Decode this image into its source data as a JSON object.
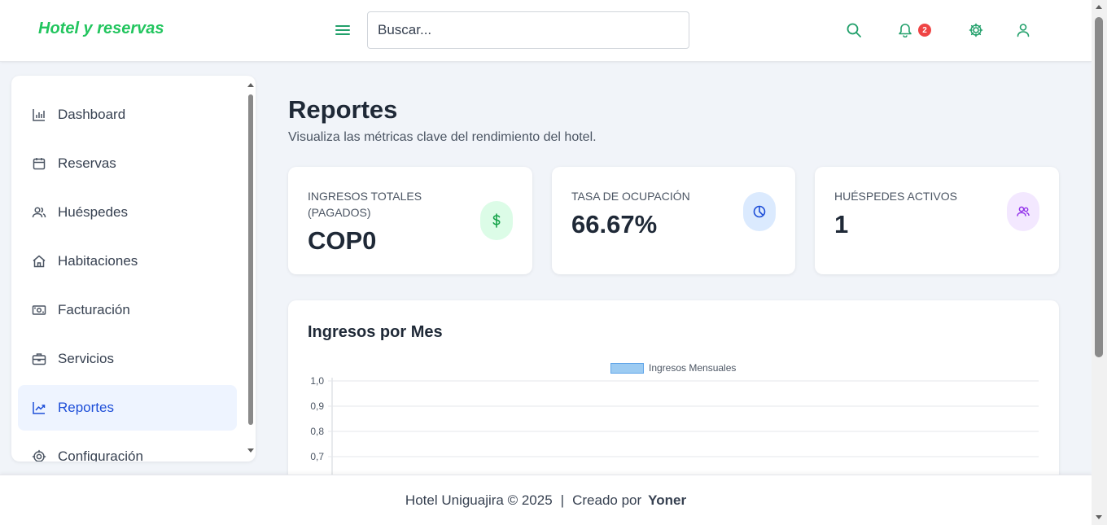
{
  "header": {
    "brand": "Hotel y reservas",
    "search_placeholder": "Buscar...",
    "notification_count": "2",
    "icons": [
      "menu-icon",
      "search-icon",
      "bell-icon",
      "gear-icon",
      "user-icon"
    ]
  },
  "sidebar": {
    "items": [
      {
        "label": "Dashboard",
        "icon": "bar-chart-icon"
      },
      {
        "label": "Reservas",
        "icon": "calendar-icon"
      },
      {
        "label": "Huéspedes",
        "icon": "users-icon"
      },
      {
        "label": "Habitaciones",
        "icon": "home-icon"
      },
      {
        "label": "Facturación",
        "icon": "banknote-icon"
      },
      {
        "label": "Servicios",
        "icon": "briefcase-icon"
      },
      {
        "label": "Reportes",
        "icon": "trend-icon",
        "active": true
      },
      {
        "label": "Configuración",
        "icon": "gear-icon"
      }
    ]
  },
  "main": {
    "title": "Reportes",
    "subtitle": "Visualiza las métricas clave del rendimiento del hotel.",
    "cards": [
      {
        "title": "INGRESOS TOTALES (PAGADOS)",
        "value": "COP0",
        "icon": "dollar-icon",
        "color": "#16a34a",
        "bg": "#dcfce7"
      },
      {
        "title": "TASA DE OCUPACIÓN",
        "value": "66.67%",
        "icon": "pie-icon",
        "color": "#1d4ed8",
        "bg": "#dbeafe"
      },
      {
        "title": "HUÉSPEDES ACTIVOS",
        "value": "1",
        "icon": "users-icon",
        "color": "#9333ea",
        "bg": "#f3e8ff"
      }
    ],
    "chart_title": "Ingresos por Mes"
  },
  "chart_data": {
    "type": "bar",
    "categories": [],
    "series": [
      {
        "name": "Ingresos Mensuales",
        "values": []
      }
    ],
    "yticks": [
      "1,0",
      "0,9",
      "0,8",
      "0,7"
    ],
    "ylim": [
      0,
      1.0
    ],
    "legend": "top-center",
    "grid": true,
    "colors": {
      "fill": "#9ccbf2",
      "stroke": "#60a5e8"
    }
  },
  "footer": {
    "text": "Hotel Uniguajira © 2025",
    "separator": "|",
    "created_by": "Creado por",
    "author": "Yoner"
  },
  "colors": {
    "brand": "#22c55e",
    "accent": "#22a06b",
    "active_nav": "#1d4ed8",
    "badge": "#ef4444"
  }
}
